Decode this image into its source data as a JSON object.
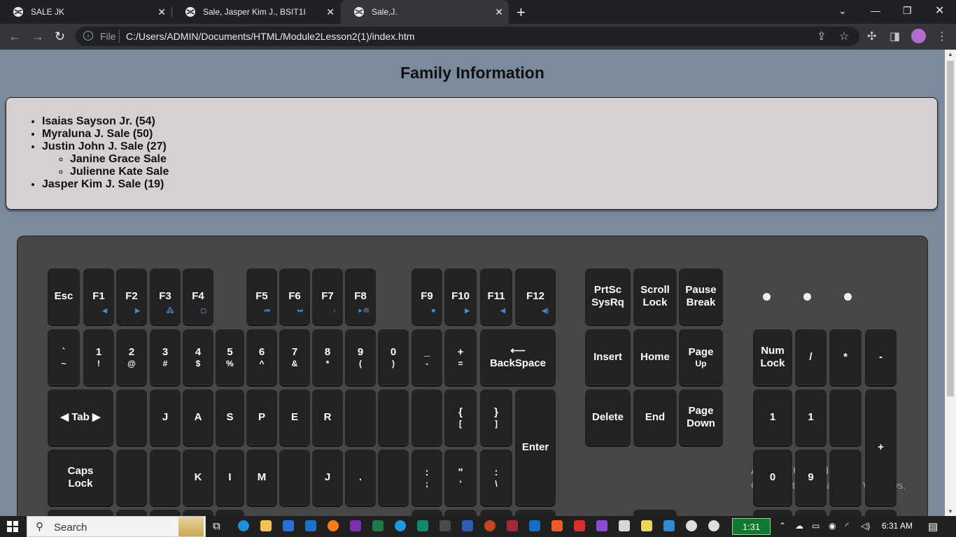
{
  "tabs": [
    {
      "label": "SALE JK",
      "active": false
    },
    {
      "label": "Sale, Jasper Kim J., BSIT1I",
      "active": false
    },
    {
      "label": "Sale,J.",
      "active": true
    }
  ],
  "omnibox": {
    "scheme_label": "File",
    "url": "C:/Users/ADMIN/Documents/HTML/Module2Lesson2(1)/index.htm"
  },
  "page": {
    "title": "Family Information",
    "family": {
      "members": [
        "Isaias Sayson Jr. (54)",
        "Myraluna J. Sale (50)",
        "Justin John J. Sale (27)",
        "Jasper Kim J. Sale (19)"
      ],
      "children_of_justin": [
        "Janine Grace Sale",
        "Julienne Kate Sale"
      ]
    }
  },
  "keyboard": {
    "row_f": [
      {
        "id": "esc",
        "t": "Esc"
      },
      {
        "id": "f1",
        "t": "F1",
        "g": "◀"
      },
      {
        "id": "f2",
        "t": "F2",
        "g": "▶"
      },
      {
        "id": "f3",
        "t": "F3",
        "g": "🖧"
      },
      {
        "id": "f4",
        "t": "F4",
        "g": "▢"
      },
      {
        "id": "f5",
        "t": "F5",
        "g": "⏮"
      },
      {
        "id": "f6",
        "t": "F6",
        "g": "⏭"
      },
      {
        "id": "f7",
        "t": "F7",
        "g": "♪"
      },
      {
        "id": "f8",
        "t": "F8",
        "g": "►/II"
      },
      {
        "id": "f9",
        "t": "F9",
        "g": "■"
      },
      {
        "id": "f10",
        "t": "F10",
        "g": "▶"
      },
      {
        "id": "f11",
        "t": "F11",
        "g": "◀"
      },
      {
        "id": "f12",
        "t": "F12",
        "g": "◀)"
      },
      {
        "id": "prtsc",
        "t": "PrtSc",
        "s": "SysRq"
      },
      {
        "id": "scroll",
        "t": "Scroll",
        "s": "Lock"
      },
      {
        "id": "pause",
        "t": "Pause",
        "s": "Break"
      }
    ],
    "row_num": [
      {
        "id": "tilde",
        "t": "`",
        "s": "~"
      },
      {
        "id": "k1",
        "t": "1",
        "s": "!"
      },
      {
        "id": "k2",
        "t": "2",
        "s": "@"
      },
      {
        "id": "k3",
        "t": "3",
        "s": "#"
      },
      {
        "id": "k4",
        "t": "4",
        "s": "$"
      },
      {
        "id": "k5",
        "t": "5",
        "s": "%"
      },
      {
        "id": "k6",
        "t": "6",
        "s": "^"
      },
      {
        "id": "k7",
        "t": "7",
        "s": "&"
      },
      {
        "id": "k8",
        "t": "8",
        "s": "*"
      },
      {
        "id": "k9",
        "t": "9",
        "s": "("
      },
      {
        "id": "k0",
        "t": "0",
        "s": ")"
      },
      {
        "id": "minus",
        "t": "_",
        "s": "-"
      },
      {
        "id": "plus",
        "t": "+",
        "s": "="
      },
      {
        "id": "backspace",
        "t": "⟵",
        "s": "BackSpace"
      },
      {
        "id": "insert",
        "t": "Insert"
      },
      {
        "id": "home",
        "t": "Home"
      },
      {
        "id": "pageup",
        "t": "Page",
        "s": "Up"
      },
      {
        "id": "numlock",
        "t": "Num",
        "s": "Lock"
      },
      {
        "id": "npdiv",
        "t": "/"
      },
      {
        "id": "npmul",
        "t": "*"
      },
      {
        "id": "npminus",
        "t": "-"
      }
    ],
    "row_tab": [
      {
        "id": "tab",
        "t": "◀ Tab ▶"
      },
      {
        "id": "q",
        "t": ""
      },
      {
        "id": "w",
        "t": "J"
      },
      {
        "id": "e",
        "t": "A"
      },
      {
        "id": "r",
        "t": "S"
      },
      {
        "id": "t",
        "t": "P"
      },
      {
        "id": "y",
        "t": "E"
      },
      {
        "id": "u",
        "t": "R"
      },
      {
        "id": "i",
        "t": ""
      },
      {
        "id": "o",
        "t": ""
      },
      {
        "id": "p",
        "t": ""
      },
      {
        "id": "lbracket",
        "t": "{",
        "s": "["
      },
      {
        "id": "rbracket",
        "t": "}",
        "s": "]"
      },
      {
        "id": "enter",
        "t": "Enter"
      },
      {
        "id": "delete",
        "t": "Delete"
      },
      {
        "id": "end",
        "t": "End"
      },
      {
        "id": "pagedown",
        "t": "Page",
        "s": "Down"
      },
      {
        "id": "np7",
        "t": "1"
      },
      {
        "id": "np8",
        "t": "1"
      },
      {
        "id": "np9",
        "t": ""
      },
      {
        "id": "npplus",
        "t": "+"
      }
    ],
    "row_caps": [
      {
        "id": "caps",
        "t": "Caps",
        "s": "Lock"
      },
      {
        "id": "a",
        "t": ""
      },
      {
        "id": "s",
        "t": ""
      },
      {
        "id": "d",
        "t": "K"
      },
      {
        "id": "f",
        "t": "I"
      },
      {
        "id": "g",
        "t": "M"
      },
      {
        "id": "h",
        "t": ""
      },
      {
        "id": "j",
        "t": "J"
      },
      {
        "id": "k",
        "t": "."
      },
      {
        "id": "l",
        "t": ""
      },
      {
        "id": "semicolon",
        "t": ":",
        "s": ";"
      },
      {
        "id": "quote",
        "t": "\"",
        "s": "'"
      },
      {
        "id": "backslash",
        "t": ":",
        "s": "\\"
      },
      {
        "id": "np4",
        "t": "0"
      },
      {
        "id": "np5",
        "t": "9"
      },
      {
        "id": "np6",
        "t": ""
      }
    ]
  },
  "watermark": {
    "line1": "Activate Windows",
    "line2": "Go to Settings to activate Windows."
  },
  "taskbar": {
    "search_label": "Search",
    "clock_badge": "1:31",
    "time": "6:31 AM"
  }
}
